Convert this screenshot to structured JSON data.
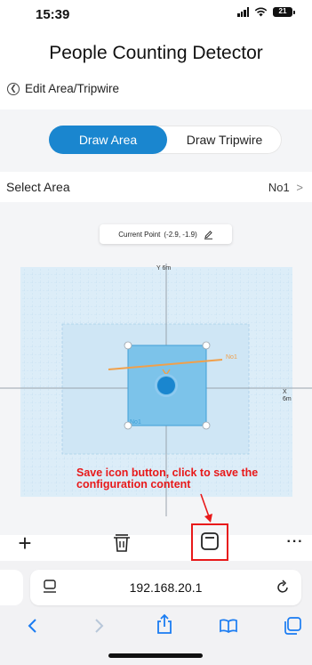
{
  "status_bar": {
    "time": "15:39",
    "battery": "21"
  },
  "header": {
    "title": "People Counting Detector",
    "back_label": "Edit Area/Tripwire"
  },
  "tabs": [
    {
      "label": "Draw Area",
      "active": true
    },
    {
      "label": "Draw Tripwire",
      "active": false
    }
  ],
  "select_area": {
    "label": "Select Area",
    "value": "No1",
    "chevron": ">"
  },
  "current_point": {
    "label": "Current Point",
    "value": "(-2.9,  -1.9)"
  },
  "canvas": {
    "y_axis_label": "Y 6m",
    "x_axis_label_x": "X",
    "x_axis_label_m": "6m",
    "tripwire_label": "No1",
    "area_label": "No1",
    "area_color": "#5bb4e4",
    "tripwire_color": "#f0a04b"
  },
  "annotation": {
    "text": "Save icon button, click to save the configuration content",
    "color": "#e8191a"
  },
  "toolbar": {
    "add_label": "+",
    "more_label": "···"
  },
  "browser": {
    "url": "192.168.20.1"
  },
  "colors": {
    "accent": "#1a86cf"
  }
}
